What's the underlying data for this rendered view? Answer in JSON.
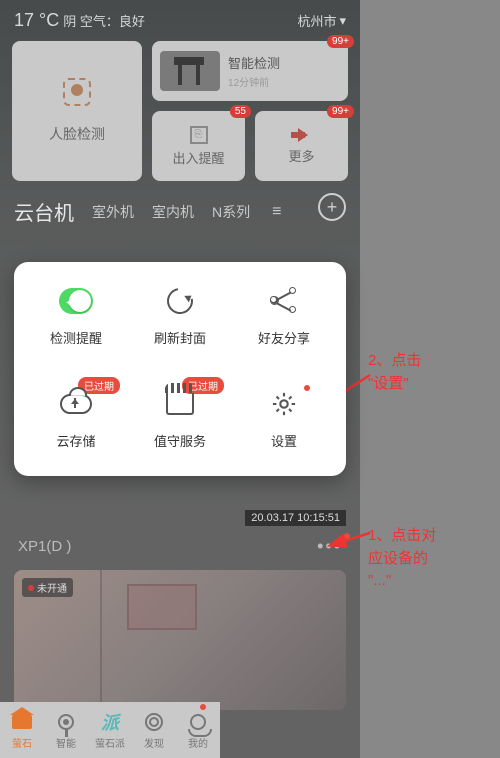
{
  "header": {
    "temp": "17 °C",
    "weather": "阴 空气：良好",
    "city": "杭州市"
  },
  "cards": {
    "face": "人脸检测",
    "smart": {
      "title": "智能检测",
      "time": "12分钟前",
      "badge": "99+"
    },
    "door": {
      "label": "出入提醒",
      "badge": "55"
    },
    "more": {
      "label": "更多",
      "badge": "99+"
    }
  },
  "tabs": {
    "active": "云台机",
    "t1": "室外机",
    "t2": "室内机",
    "t3": "N系列"
  },
  "popup": {
    "detect": "检测提醒",
    "refresh": "刷新封面",
    "share": "好友分享",
    "cloud": "云存储",
    "duty": "值守服务",
    "settings": "设置",
    "expired": "已过期"
  },
  "device": {
    "timestamp": "20.03.17 10:15:51",
    "name": "XP1(D                  )"
  },
  "feed": {
    "status": "未开通"
  },
  "bottom": {
    "i0": "萤石",
    "i1": "智能",
    "i2": "萤石派",
    "i3": "发现",
    "i4": "我的"
  },
  "annot": {
    "a2": "2、点击\n\"设置\"",
    "a1": "1、点击对\n应设备的\n\"...\""
  }
}
